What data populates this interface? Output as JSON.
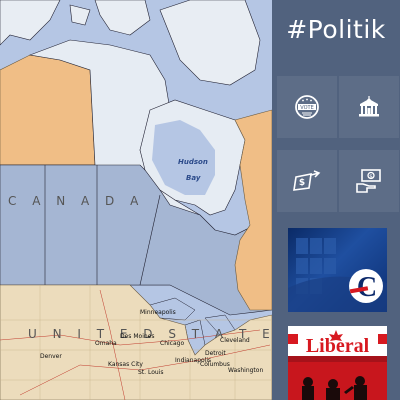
{
  "map": {
    "labels": {
      "hudson": "Hudson",
      "bay": "Bay",
      "canada": "C A N A D A",
      "united_states": "U N I T E D   S T A T E S"
    },
    "cities": [
      "Minneapolis",
      "Detroit",
      "Chicago",
      "Cleveland",
      "Washington",
      "Denver",
      "Kansas City",
      "St. Louis",
      "Omaha",
      "Des Moines",
      "Indianapolis",
      "Columbus"
    ]
  },
  "panel": {
    "title": "#Politik",
    "tiles": [
      {
        "name": "vote",
        "icon": "vote-badge-icon",
        "label": "VOTE"
      },
      {
        "name": "government",
        "icon": "government-building-icon"
      },
      {
        "name": "money-transfer",
        "icon": "money-transfer-icon"
      },
      {
        "name": "cash-hand",
        "icon": "hand-cash-icon"
      }
    ],
    "news": [
      {
        "name": "conservative-news",
        "logo": "C"
      },
      {
        "name": "liberal-news",
        "logo": "Liberal"
      }
    ]
  },
  "colors": {
    "panel_bg": "#51627e",
    "accent_red": "#d71920",
    "water": "#b9c9e6"
  }
}
